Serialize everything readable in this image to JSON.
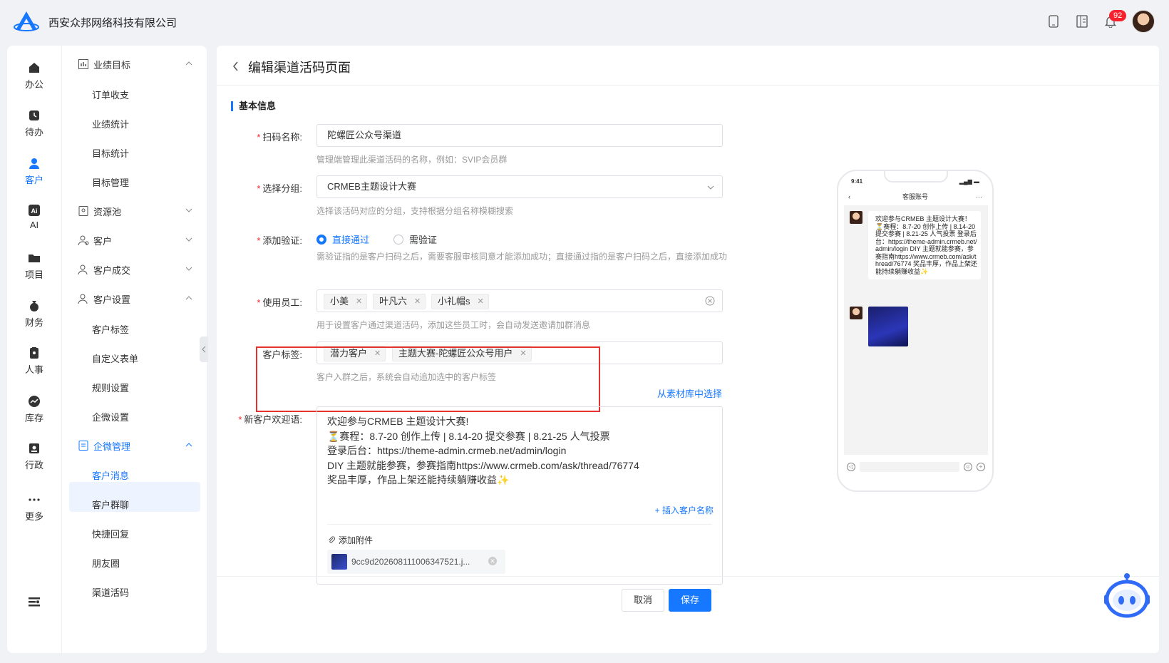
{
  "topbar": {
    "company": "西安众邦网络科技有限公司",
    "notification_count": "92",
    "icons": [
      "phone-icon",
      "book-icon",
      "bell-icon"
    ]
  },
  "leftnav": {
    "items": [
      {
        "label": "办公",
        "icon": "home-icon"
      },
      {
        "label": "待办",
        "icon": "clock-icon"
      },
      {
        "label": "客户",
        "icon": "user-icon",
        "active": true
      },
      {
        "label": "AI",
        "icon": "ai-icon"
      },
      {
        "label": "项目",
        "icon": "folder-icon"
      },
      {
        "label": "财务",
        "icon": "money-bag-icon"
      },
      {
        "label": "人事",
        "icon": "badge-icon"
      },
      {
        "label": "库存",
        "icon": "chart-icon"
      },
      {
        "label": "行政",
        "icon": "id-card-icon"
      },
      {
        "label": "更多",
        "icon": "more-icon"
      }
    ]
  },
  "submenu": {
    "groups": [
      {
        "label": "业绩目标",
        "expanded": true,
        "children": [
          "订单收支",
          "业绩统计",
          "目标统计",
          "目标管理"
        ]
      },
      {
        "label": "资源池",
        "expanded": false
      },
      {
        "label": "客户",
        "expanded": false
      },
      {
        "label": "客户成交",
        "expanded": false
      },
      {
        "label": "客户设置",
        "expanded": true,
        "children": [
          "客户标签",
          "自定义表单",
          "规则设置",
          "企微设置"
        ]
      },
      {
        "label": "企微管理",
        "expanded": true,
        "active": true,
        "children": [
          "客户消息",
          "客户群聊",
          "快捷回复",
          "朋友圈",
          "渠道活码"
        ]
      }
    ],
    "active_item": "客户消息"
  },
  "page": {
    "title": "编辑渠道活码页面",
    "section": "基本信息"
  },
  "form": {
    "name": {
      "label": "扫码名称:",
      "value": "陀螺匠公众号渠道",
      "hint": "管理端管理此渠道活码的名称，例如：SVIP会员群"
    },
    "group": {
      "label": "选择分组:",
      "value": "CRMEB主题设计大赛",
      "hint": "选择该活码对应的分组，支持根据分组名称模糊搜索"
    },
    "verify": {
      "label": "添加验证:",
      "options": [
        "直接通过",
        "需验证"
      ],
      "selected": "直接通过",
      "hint": "需验证指的是客户扫码之后，需要客服审核同意才能添加成功；直接通过指的是客户扫码之后，直接添加成功"
    },
    "staff": {
      "label": "使用员工:",
      "tags": [
        "小美",
        "叶凡六",
        "小礼帽s"
      ],
      "hint": "用于设置客户通过渠道活码，添加这些员工时，会自动发送邀请加群消息"
    },
    "customer_tags": {
      "label": "客户标签:",
      "tags": [
        "潜力客户",
        "主题大赛-陀螺匠公众号用户"
      ],
      "hint": "客户入群之后，系统会自动追加选中的客户标签"
    },
    "material_link": "从素材库中选择",
    "welcome": {
      "label": "新客户欢迎语:",
      "lines": [
        "欢迎参与CRMEB 主题设计大赛!",
        "⏳赛程：8.7-20 创作上传 | 8.14-20 提交参赛 | 8.21-25 人气投票",
        "登录后台：https://theme-admin.crmeb.net/admin/login",
        "DIY 主题就能参赛，参赛指南https://www.crmeb.com/ask/thread/76774",
        "奖品丰厚，作品上架还能持续躺赚收益✨"
      ],
      "insert_link": "+ 插入客户名称",
      "attach_label": "添加附件",
      "attachment": "9cc9d202608111006347521.j..."
    }
  },
  "preview": {
    "time": "9:41",
    "title": "客服账号",
    "message": "欢迎参与CRMEB 主题设计大赛！⏳赛程：8.7-20 创作上传 | 8.14-20 提交参赛 | 8.21-25 人气投票 登录后台：https://theme-admin.crmeb.net/admin/login DIY 主题就能参赛，参赛指南https://www.crmeb.com/ask/thread/76774 奖品丰厚，作品上架还能持续躺赚收益✨"
  },
  "footer": {
    "cancel": "取消",
    "save": "保存"
  },
  "colors": {
    "accent": "#1677ff",
    "highlight": "#e5322f"
  }
}
